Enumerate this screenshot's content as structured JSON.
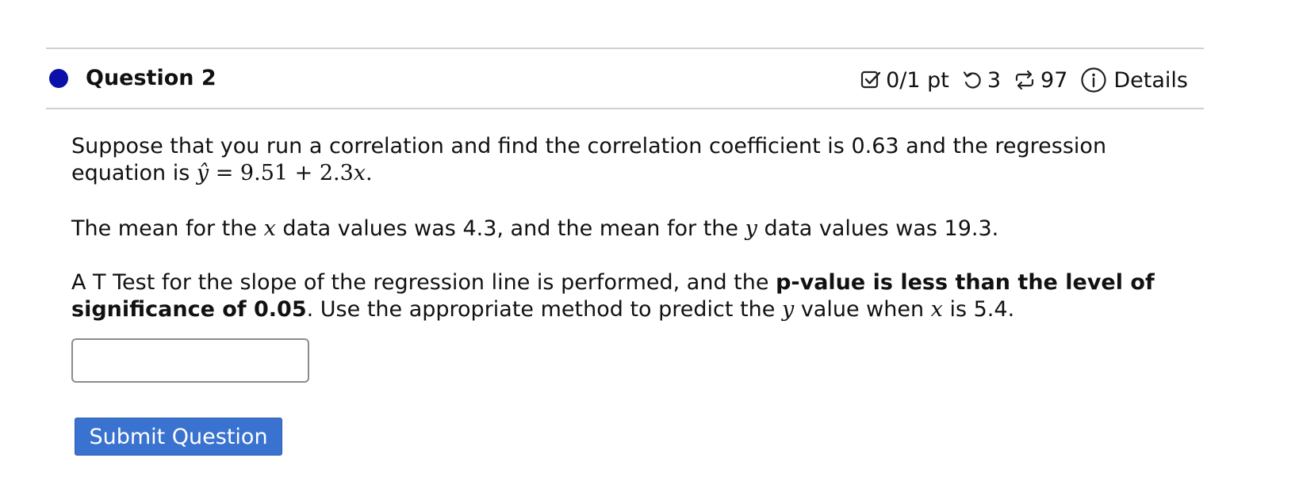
{
  "question": {
    "title": "Question 2",
    "score": "0/1 pt",
    "retries": "3",
    "attempts": "97",
    "details_label": "Details",
    "status_dot_color": "#0a10a8"
  },
  "icons": {
    "score": "checkbox-icon",
    "retries": "retry-icon",
    "attempts": "repeat-icon",
    "details": "info-icon"
  },
  "body": {
    "p1_text": "Suppose that you run a correlation and find the correlation coefficient is 0.63 and the regression equation is ",
    "p1_eq_yhat": "ŷ",
    "p1_eq_rest": " = 9.51 + 2.3",
    "p1_eq_x": "x",
    "p1_eq_end": ".",
    "p2_a": "The mean for the ",
    "p2_x": "x",
    "p2_b": " data values was 4.3, and the mean for the ",
    "p2_y": "y",
    "p2_c": " data values was 19.3.",
    "p3_a": "A T Test for the slope of the regression line is performed, and the ",
    "p3_bold": "p-value is less than the level of significance of 0.05",
    "p3_b": ". Use the appropriate method to predict the ",
    "p3_y": "y",
    "p3_c": " value when ",
    "p3_x": "x",
    "p3_d": " is 5.4."
  },
  "answer": {
    "value": "",
    "placeholder": ""
  },
  "submit": {
    "label": "Submit Question",
    "color": "#3a72cf"
  }
}
